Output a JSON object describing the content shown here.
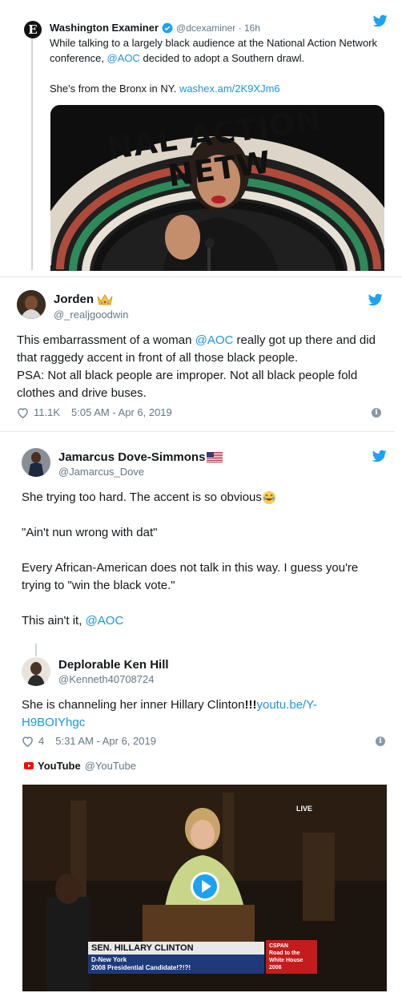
{
  "tweet_examiner": {
    "name": "Washington Examiner",
    "handle": "@dcexaminer · 16h",
    "text_1": "While talking to a largely black audience at the National Action Network conference, ",
    "mention": "@AOC",
    "text_2": " decided to adopt a Southern drawl.",
    "text_3": "She's from the Bronx in NY. ",
    "link": "washex.am/2K9XJm6",
    "image_banner": "NAL ACTION NETW"
  },
  "tweet_jorden": {
    "name": "Jorden",
    "handle": "@_realjgoodwin",
    "text_1": "This embarrassment of a woman ",
    "mention": "@AOC",
    "text_2": " really got up there and did that raggedy accent in front of all those black people.",
    "text_3": "PSA: Not all black people are improper. Not all black people fold clothes and drive buses.",
    "likes": "11.1K",
    "timestamp": "5:05 AM - Apr 6, 2019"
  },
  "tweet_jamarcus": {
    "name": "Jamarcus Dove-Simmons",
    "handle": "@Jamarcus_Dove",
    "line_1": "She trying too hard. The accent is so obvious",
    "line_2": "\"Ain't nun wrong with dat\"",
    "line_3": "Every African-American does not talk in this way. I guess you're trying to \"win the black vote.\"",
    "line_4": "This ain't it, ",
    "mention": "@AOC"
  },
  "tweet_ken": {
    "name": "Deplorable Ken Hill",
    "handle": "@Kenneth40708724",
    "text_1": "She is channeling her inner Hillary Clinton",
    "bangs": "!!!",
    "link": "youtu.be/Y-H9BOIYhgc",
    "likes": "4",
    "timestamp": "5:31 AM - Apr 6, 2019",
    "youtube_name": "YouTube",
    "youtube_handle": "@YouTube",
    "video_caption_name": "SEN. HILLARY CLINTON",
    "video_caption_line_1": "D-New York",
    "video_caption_line_2": "2008 Presidential Candidate!?!?!",
    "video_cspan_1": "CSPAN",
    "video_cspan_2": "Road to the",
    "video_cspan_3": "White House",
    "video_cspan_4": "2008",
    "video_live": "LIVE"
  },
  "colors": {
    "link": "#1b95e0",
    "twitter_blue": "#1da1f2",
    "youtube_red": "#ff0000",
    "text": "#14171a",
    "muted": "#657786"
  },
  "icons": [
    "examiner-logo-icon",
    "verified-badge-icon",
    "twitter-bird-icon",
    "crown-emoji-icon",
    "us-flag-icon",
    "laughing-emoji-icon",
    "heart-icon",
    "info-icon",
    "youtube-logo-icon",
    "play-button-icon"
  ]
}
